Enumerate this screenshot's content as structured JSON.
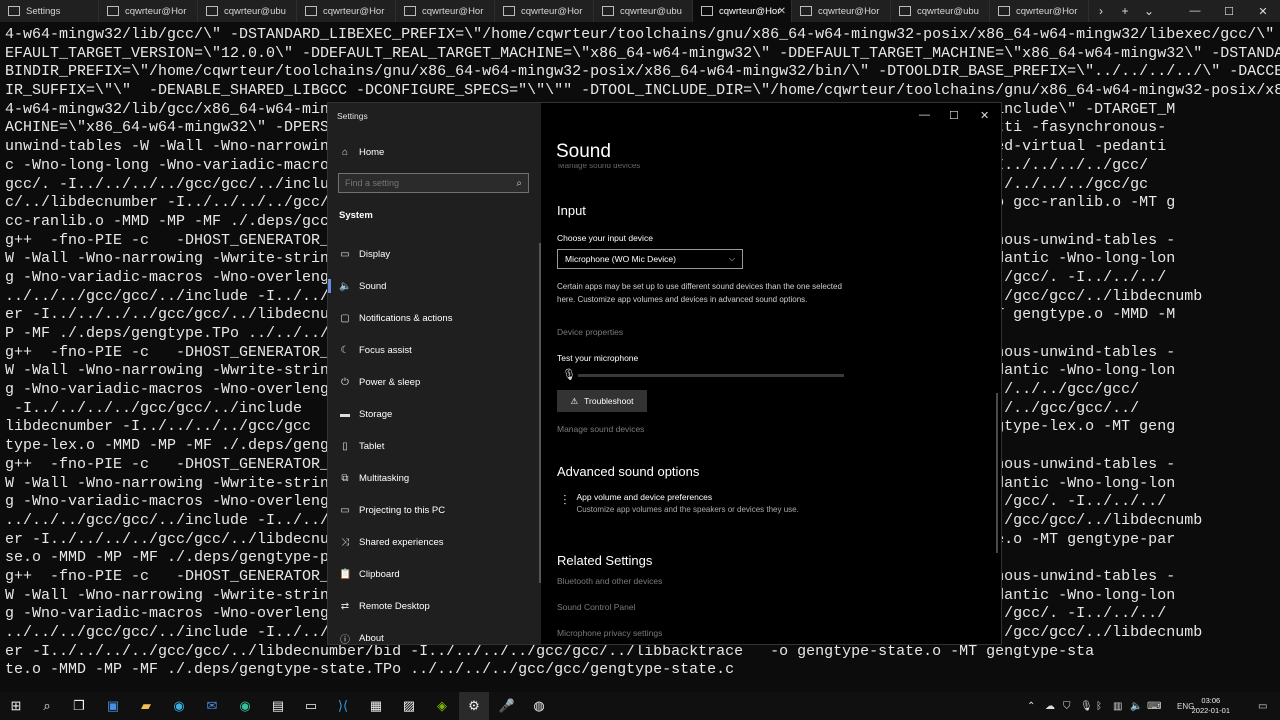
{
  "tabbar": {
    "tabs": [
      {
        "label": "Settings",
        "active": false
      },
      {
        "label": "cqwrteur@Hor",
        "active": false
      },
      {
        "label": "cqwrteur@ubu",
        "active": false
      },
      {
        "label": "cqwrteur@Hor",
        "active": false
      },
      {
        "label": "cqwrteur@Hor",
        "active": false
      },
      {
        "label": "cqwrteur@Hor",
        "active": false
      },
      {
        "label": "cqwrteur@ubu",
        "active": false
      },
      {
        "label": "cqwrteur@Hor",
        "active": true
      },
      {
        "label": "cqwrteur@Hor",
        "active": false
      },
      {
        "label": "cqwrteur@ubu",
        "active": false
      },
      {
        "label": "cqwrteur@Hor",
        "active": false
      }
    ],
    "add_tab": "+",
    "dropdown": "⌄",
    "scroll_right": "›"
  },
  "terminal": {
    "lines": [
      "4-w64-mingw32/lib/gcc/\\\" -DSTANDARD_LIBEXEC_PREFIX=\\\"/home/cqwrteur/toolchains/gnu/x86_64-w64-mingw32-posix/x86_64-w64-mingw32/libexec/gcc/\\\" -DD",
      "EFAULT_TARGET_VERSION=\\\"12.0.0\\\" -DDEFAULT_REAL_TARGET_MACHINE=\\\"x86_64-w64-mingw32\\\" -DDEFAULT_TARGET_MACHINE=\\\"x86_64-w64-mingw32\\\" -DSTANDARD_",
      "BINDIR_PREFIX=\\\"/home/cqwrteur/toolchains/gnu/x86_64-w64-mingw32-posix/x86_64-w64-mingw32/bin/\\\" -DTOOLDIR_BASE_PREFIX=\\\"../../../../\\\" -DACCEL_D",
      "IR_SUFFIX=\\\"\\\"  -DENABLE_SHARED_LIBGCC -DCONFIGURE_SPECS=\"\\\"\\\"\" -DTOOL_INCLUDE_DIR=\\\"/home/cqwrteur/toolchains/gnu/x86_64-w64-mingw32-posix/x86_6",
      "4-w64-mingw32/lib/gcc/x86_64-w64-mingw32/                                                           =\\\"/mingw/include\\\" -DTARGET_M",
      "ACHINE=\\\"x86_64-w64-mingw32\\\" -DPERSON                                                             ions -fno-rtti -fasynchronous-",
      "unwind-tables -W -Wall -Wno-narrowing                                                               -Woverloaded-virtual -pedanti",
      "c -Wno-long-long -Wno-variadic-macros                                                               /gcc/gcc -I../../../../gcc/",
      "gcc/. -I../../../../gcc/gcc/../includ                                                               bcody  -I../../../../gcc/gc",
      "c/../libdecnumber -I../../../../gcc/                                                                ktrace   -o gcc-ranlib.o -MT g",
      "cc-ranlib.o -MMD -MP -MF ./.deps/gcc-",
      "g++  -fno-PIE -c   -DHOST_GENERATOR_FI                                                              -fasynchronous-unwind-tables -",
      "W -Wall -Wno-narrowing -Wwrite-string                                                               irtual -pedantic -Wno-long-lon",
      "g -Wno-variadic-macros -Wno-overlengt                                                               ../../../../gcc/. -I../../../",
      "../../../gcc/gcc/../include -I../../.                                                               ../../../../gcc/gcc/../libdecnumb",
      "er -I../../../../gcc/gcc/../libdecnu                                                                gtype.o -MT gengtype.o -MMD -M",
      "P -MF ./.deps/gengtype.TPo ../../../",
      "g++  -fno-PIE -c   -DHOST_GENERATOR_FI                                                              -fasynchronous-unwind-tables -",
      "W -Wall -Wno-narrowing -Wwrite-string                                                               irtual -pedantic -Wno-long-lon",
      "g -Wno-variadic-macros -Wno-overlengt                                                               gcc -I../../../../gcc/gcc/",
      " -I../../../../gcc/gcc/../include                                                                    -I../../../../gcc/gcc/../",
      "libdecnumber -I../../../../gcc/gcc                                                                  e   -o gengtype-lex.o -MT geng",
      "type-lex.o -MMD -MP -MF ./.deps/geng",
      "g++  -fno-PIE -c   -DHOST_GENERATOR_FI                                                              -fasynchronous-unwind-tables -",
      "W -Wall -Wno-narrowing -Wwrite-string                                                               irtual -pedantic -Wno-long-lon",
      "g -Wno-variadic-macros -Wno-overlengt                                                               ../../../../gcc/. -I../../../",
      "../../../gcc/gcc/../include -I../../.                                                               ../../../../gcc/gcc/../libdecnumb",
      "er -I../../../../gcc/gcc/../libdecnu                                                                gtype-parse.o -MT gengtype-par",
      "se.o -MMD -MP -MF ./.deps/gengtype-pa",
      "g++  -fno-PIE -c   -DHOST_GENERATOR_FI                                                              -fasynchronous-unwind-tables -",
      "W -Wall -Wno-narrowing -Wwrite-string                                                               irtual -pedantic -Wno-long-lon",
      "g -Wno-variadic-macros -Wno-overlengt                                                               ../../../../gcc/. -I../../../",
      "../../../gcc/gcc/../include -I../../.                                                               ../../../../gcc/gcc/../libdecnumb",
      "er -I../../../../gcc/gcc/../libdecnumber/bid -I../../../../gcc/gcc/../libbacktrace   -o gengtype-state.o -MT gengtype-sta",
      "te.o -MMD -MP -MF ./.deps/gengtype-state.TPo ../../../../gcc/gcc/gengtype-state.c"
    ]
  },
  "settings": {
    "window_title": "Settings",
    "home_label": "Home",
    "search_placeholder": "Find a setting",
    "section_label": "System",
    "nav_items": [
      {
        "label": "Display",
        "icon": "display-icon",
        "glyph": "▭"
      },
      {
        "label": "Sound",
        "icon": "speaker-icon",
        "glyph": "🔈"
      },
      {
        "label": "Notifications & actions",
        "icon": "notification-icon",
        "glyph": "▢"
      },
      {
        "label": "Focus assist",
        "icon": "moon-icon",
        "glyph": "☾"
      },
      {
        "label": "Power & sleep",
        "icon": "power-icon",
        "glyph": "⏻"
      },
      {
        "label": "Storage",
        "icon": "storage-icon",
        "glyph": "▬"
      },
      {
        "label": "Tablet",
        "icon": "tablet-icon",
        "glyph": "▯"
      },
      {
        "label": "Multitasking",
        "icon": "multitasking-icon",
        "glyph": "⧉"
      },
      {
        "label": "Projecting to this PC",
        "icon": "projector-icon",
        "glyph": "▭"
      },
      {
        "label": "Shared experiences",
        "icon": "shared-icon",
        "glyph": "⤨"
      },
      {
        "label": "Clipboard",
        "icon": "clipboard-icon",
        "glyph": "📋"
      },
      {
        "label": "Remote Desktop",
        "icon": "remote-desktop-icon",
        "glyph": "⇄"
      },
      {
        "label": "About",
        "icon": "info-icon",
        "glyph": "ⓘ"
      }
    ],
    "selected_nav": "Sound",
    "page_title": "Sound",
    "cut_link": "Manage sound devices",
    "input": {
      "heading": "Input",
      "choose_label": "Choose your input device",
      "selected_device": "Microphone (WO Mic Device)",
      "description": "Certain apps may be set up to use different sound devices than the one selected here. Customize app volumes and devices in advanced sound options.",
      "device_properties": "Device properties",
      "test_label": "Test your microphone",
      "mic_level": 0,
      "troubleshoot_label": "Troubleshoot",
      "manage_devices": "Manage sound devices"
    },
    "advanced": {
      "heading": "Advanced sound options",
      "app_volume_title": "App volume and device preferences",
      "app_volume_desc": "Customize app volumes and the speakers or devices they use."
    },
    "related": {
      "heading": "Related Settings",
      "links": [
        "Bluetooth and other devices",
        "Sound Control Panel",
        "Microphone privacy settings"
      ]
    }
  },
  "taskbar": {
    "language": "ENG",
    "time": "03:06",
    "date": "2022-01-01"
  },
  "colors": {
    "accent": "#6a8ddb",
    "sidebar_bg": "#1f1f1f",
    "terminal_bg": "#0c0c0c"
  }
}
